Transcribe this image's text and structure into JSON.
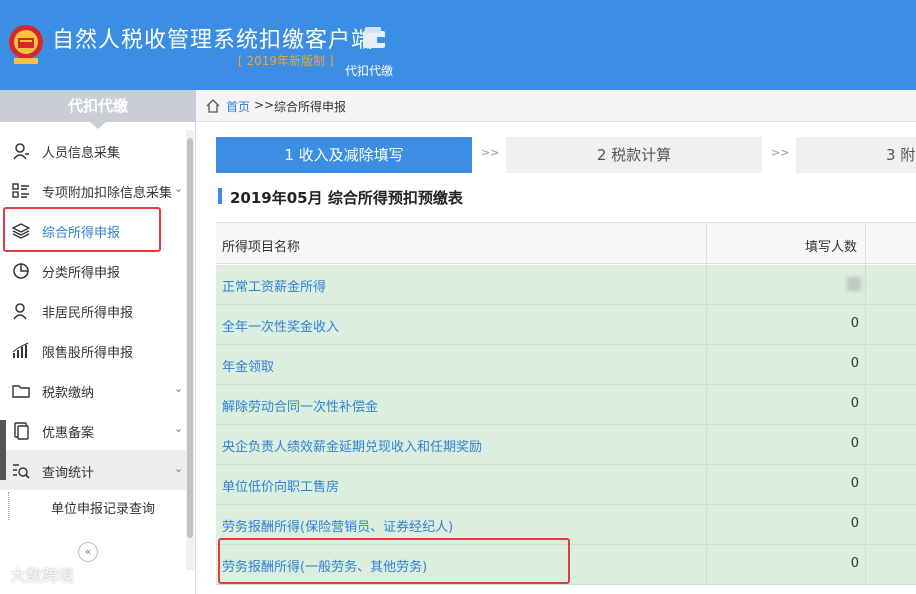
{
  "header": {
    "title": "自然人税收管理系统扣缴客户端",
    "version": "[ 2019年新版制 ]",
    "wallet_label": "代扣代缴",
    "color": "#3b8ee4"
  },
  "sidebar": {
    "heading": "代扣代缴",
    "items": [
      {
        "label": "人员信息采集",
        "icon": "person-icon"
      },
      {
        "label": "专项附加扣除信息采集",
        "icon": "list-icon"
      },
      {
        "label": "综合所得申报",
        "icon": "layers-icon",
        "active": true
      },
      {
        "label": "分类所得申报",
        "icon": "pie-chart-icon"
      },
      {
        "label": "非居民所得申报",
        "icon": "person-icon"
      },
      {
        "label": "限售股所得申报",
        "icon": "bar-chart-icon"
      },
      {
        "label": "税款缴纳",
        "icon": "folder-icon"
      },
      {
        "label": "优惠备案",
        "icon": "document-icon"
      },
      {
        "label": "查询统计",
        "icon": "search-list-icon",
        "expanded": true
      }
    ],
    "sub_items": [
      {
        "label": "单位申报记录查询"
      }
    ],
    "collapse_glyph": "«"
  },
  "breadcrumb": {
    "home": "首页",
    "separator": ">>",
    "current": "综合所得申报"
  },
  "steps": [
    {
      "label": "1 收入及减除填写",
      "active": true
    },
    {
      "label": "2 税款计算",
      "active": false
    },
    {
      "label": "3 附",
      "active": false
    }
  ],
  "step_arrow": ">>",
  "table": {
    "title": "2019年05月  综合所得预扣预缴表",
    "headers": {
      "name": "所得项目名称",
      "count": "填写人数"
    },
    "rows": [
      {
        "name": "正常工资薪金所得",
        "count": ""
      },
      {
        "name": "全年一次性奖金收入",
        "count": "0"
      },
      {
        "name": "年金领取",
        "count": "0"
      },
      {
        "name": "解除劳动合同一次性补偿金",
        "count": "0"
      },
      {
        "name": "央企负责人绩效薪金延期兑现收入和任期奖励",
        "count": "0"
      },
      {
        "name": "单位低价向职工售房",
        "count": "0"
      },
      {
        "name": "劳务报酬所得(保险营销员、证券经纪人)",
        "count": "0"
      },
      {
        "name": "劳务报酬所得(一般劳务、其他劳务)",
        "count": "0"
      }
    ]
  },
  "watermark": "大数跨境",
  "colors": {
    "accent": "#3b8ee4",
    "row_bg": "#dceedd",
    "highlight": "#e23b3b",
    "link": "#2f7fd6"
  }
}
